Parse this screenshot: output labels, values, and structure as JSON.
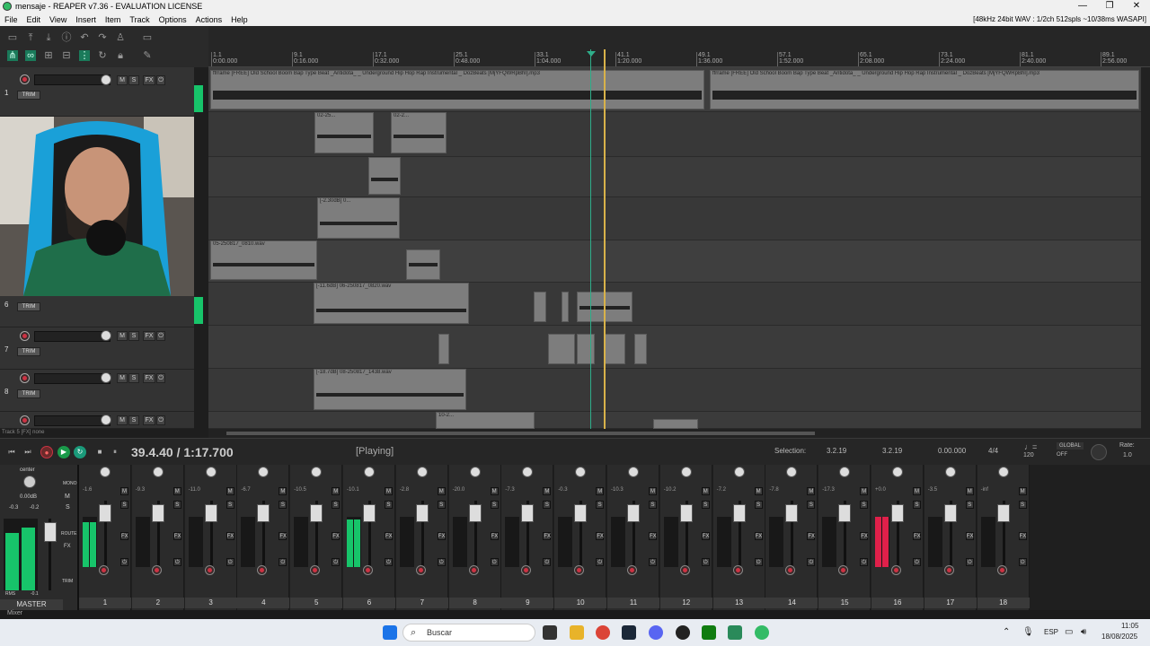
{
  "window": {
    "title": "mensaje - REAPER v7.36 - EVALUATION LICENSE"
  },
  "menu": {
    "items": [
      "File",
      "Edit",
      "View",
      "Insert",
      "Item",
      "Track",
      "Options",
      "Actions",
      "Help"
    ],
    "status": "[48kHz 24bit WAV : 1/2ch 512spls ~10/38ms WASAPI]"
  },
  "ruler": {
    "marks": [
      {
        "bar": "1.1",
        "time": "0:00.000"
      },
      {
        "bar": "9.1",
        "time": "0:16.000"
      },
      {
        "bar": "17.1",
        "time": "0:32.000"
      },
      {
        "bar": "25.1",
        "time": "0:48.000"
      },
      {
        "bar": "33.1",
        "time": "1:04.000"
      },
      {
        "bar": "41.1",
        "time": "1:20.000"
      },
      {
        "bar": "49.1",
        "time": "1:36.000"
      },
      {
        "bar": "57.1",
        "time": "1:52.000"
      },
      {
        "bar": "65.1",
        "time": "2:08.000"
      },
      {
        "bar": "73.1",
        "time": "2:24.000"
      },
      {
        "bar": "81.1",
        "time": "2:40.000"
      },
      {
        "bar": "89.1",
        "time": "2:56.000"
      }
    ]
  },
  "tracks": {
    "numbers": [
      "1",
      "6",
      "7",
      "8"
    ],
    "trim_label": "TRIM",
    "btn_m": "M",
    "btn_s": "S",
    "btn_fx": "FX"
  },
  "items": {
    "beat1": "ffrrame [FREE] Old School Boom Bap Type Beat _Antidota_ _ Underground Hip Hop Rap Instrumental _ DozBeats [MjYFQWRpBhI].mp3",
    "beat2": "ffrrame [FREE] Old School Boom Bap Type Beat _Antidota_ _ Underground Hip Hop Rap Instrumental _ DozBeats [MjYFQWRpBhI].mp3",
    "i2a": "02-25...",
    "i2b": "02-2...",
    "i4": "[-2.30dB] 0...",
    "i5": "05-250817_0810.wav",
    "i6": "[-11.6dB] 06-250817_0820.wav",
    "i8": "[-18.7dB] 08-250817_1438.wav",
    "i9": "10-2..."
  },
  "status_line": "Track 5 [FX] none",
  "transport": {
    "position": "39.4.40 / 1:17.700",
    "state": "[Playing]",
    "selection_label": "Selection:",
    "sel_start": "3.2.19",
    "sel_end": "3.2.19",
    "sel_len": "0.00.000",
    "timesig": "4/4",
    "bpm": "120",
    "global_label": "GLOBAL",
    "global_state": "OFF",
    "rate_label": "Rate:",
    "rate_value": "1.0"
  },
  "master": {
    "pan": "center",
    "vol": "0.00dB",
    "peak_l": "-0.3",
    "peak_r": "-0.2",
    "label": "MASTER",
    "mono": "MONO",
    "route": "ROUTE",
    "rms": "RMS",
    "rms_val": "-0.1"
  },
  "mixer": {
    "strips": [
      {
        "n": "1",
        "db": "-1.6",
        "level": 0.9
      },
      {
        "n": "2",
        "db": "-9.3",
        "level": 0.0
      },
      {
        "n": "3",
        "db": "-11.0",
        "level": 0.0
      },
      {
        "n": "4",
        "db": "-6.7",
        "level": 0.0
      },
      {
        "n": "5",
        "db": "-10.5",
        "level": 0.0
      },
      {
        "n": "6",
        "db": "-10.1",
        "level": 0.95
      },
      {
        "n": "7",
        "db": "-2.8",
        "level": 0.0
      },
      {
        "n": "8",
        "db": "-20.0",
        "level": 0.0
      },
      {
        "n": "9",
        "db": "-7.3",
        "level": 0.0
      },
      {
        "n": "10",
        "db": "-0.3",
        "level": 0.0
      },
      {
        "n": "11",
        "db": "-10.3",
        "level": 0.0
      },
      {
        "n": "12",
        "db": "-10.2",
        "level": 0.0
      },
      {
        "n": "13",
        "db": "-7.2",
        "level": 0.0
      },
      {
        "n": "14",
        "db": "-7.8",
        "level": 0.0
      },
      {
        "n": "15",
        "db": "-17.3",
        "level": 0.0
      },
      {
        "n": "16",
        "db": "+0.0",
        "level": 1.0
      },
      {
        "n": "17",
        "db": "-3.5",
        "level": 0.0
      },
      {
        "n": "18",
        "db": "-inf",
        "level": 0.0
      }
    ],
    "tab": "Mixer"
  },
  "taskbar": {
    "search": "Buscar",
    "lang": "ESP",
    "time": "11:05",
    "date": "18/08/2025"
  },
  "colors": {
    "accent": "#17c46a",
    "rec": "#cc3344",
    "clip": "#e0204a",
    "playcursor": "#d8b24a"
  }
}
